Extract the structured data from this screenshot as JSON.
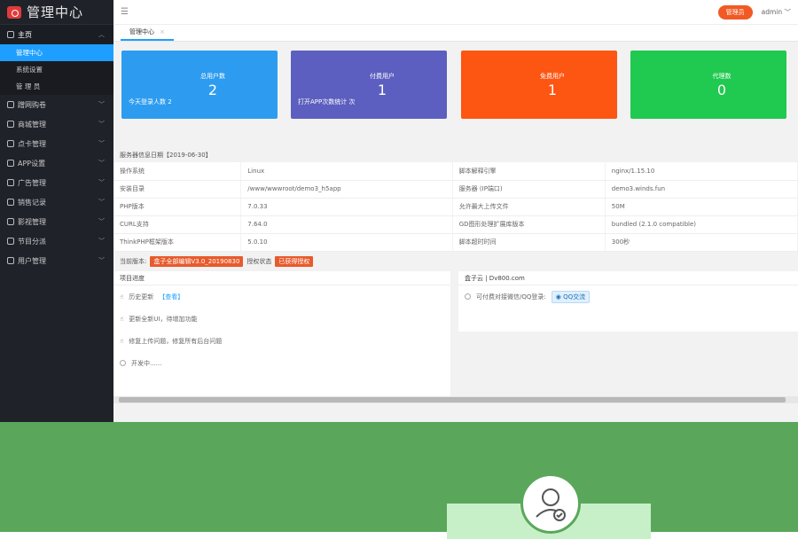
{
  "app": {
    "title": "管理中心"
  },
  "sidebar": {
    "groups": [
      {
        "label": "主页",
        "active": true,
        "items": [
          "管理中心",
          "系统设置",
          "管 理 员"
        ]
      },
      {
        "label": "蹭网购卷"
      },
      {
        "label": "商城管理"
      },
      {
        "label": "点卡管理"
      },
      {
        "label": "APP设置"
      },
      {
        "label": "广告管理"
      },
      {
        "label": "销售记录"
      },
      {
        "label": "影视管理"
      },
      {
        "label": "节目分派"
      },
      {
        "label": "用户管理"
      }
    ]
  },
  "topbar": {
    "role_button": "管理员",
    "user": "admin"
  },
  "tabs": [
    {
      "label": "管理中心"
    }
  ],
  "cards": [
    {
      "title": "总用户数",
      "value": "2",
      "extra": "今天登录人数 2",
      "color": "#2d9cf0"
    },
    {
      "title": "付费用户",
      "value": "1",
      "extra": "打开APP次数统计 次",
      "color": "#5c5fbf"
    },
    {
      "title": "免费用户",
      "value": "1",
      "extra": "",
      "color": "#fd5612"
    },
    {
      "title": "代理数",
      "value": "0",
      "extra": "",
      "color": "#20c94f"
    }
  ],
  "server": {
    "title": "服务器信息日期【2019-06-30】",
    "rows": [
      [
        "操作系统",
        "Linux",
        "脚本解释引擎",
        "nginx/1.15.10"
      ],
      [
        "安装目录",
        "/www/wwwroot/demo3_h5app",
        "服务器 (IP端口)",
        "demo3.winds.fun"
      ],
      [
        "PHP版本",
        "7.0.33",
        "允许最大上传文件",
        "50M"
      ],
      [
        "CURL支持",
        "7.64.0",
        "GD图形处理扩展库版本",
        "bundled (2.1.0 compatible)"
      ],
      [
        "ThinkPHP框架版本",
        "5.0.10",
        "脚本超时时间",
        "300秒"
      ]
    ],
    "version_label": "当前版本:",
    "version_tag": "盒子全部编辑V3.0_20190830",
    "auth_label": "授权状态",
    "auth_tag": "已获得授权"
  },
  "progress": {
    "title": "项目进度",
    "items": [
      {
        "text": "历史更新",
        "link": "【查看】"
      },
      {
        "text": "更新全新UI，待增加功能"
      },
      {
        "text": "修复上传问题，修复所有后台问题"
      },
      {
        "text": "开发中......"
      }
    ]
  },
  "contact": {
    "title": "盒子云 | Dv800.com",
    "text": "可付费对接微信/QQ登录:",
    "qq_label": "QQ交流"
  }
}
